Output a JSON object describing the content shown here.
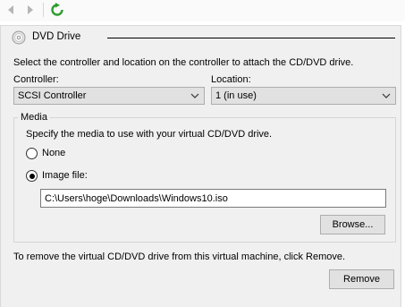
{
  "toolbar": {
    "back_icon": "arrow-left-icon",
    "forward_icon": "arrow-right-icon",
    "refresh_icon": "refresh-icon",
    "refresh_color": "#2e9c2e"
  },
  "section": {
    "title": "DVD Drive",
    "icon": "dvd-disc-icon"
  },
  "instructions": "Select the controller and location on the controller to attach the CD/DVD drive.",
  "controller": {
    "label": "Controller:",
    "value": "SCSI Controller"
  },
  "location": {
    "label": "Location:",
    "value": "1 (in use)"
  },
  "media": {
    "group_label": "Media",
    "description": "Specify the media to use with your virtual CD/DVD drive.",
    "none_label": "None",
    "image_file_label": "Image file:",
    "selected": "image_file",
    "image_path": "C:\\Users\\hoge\\Downloads\\Windows10.iso",
    "browse_label": "Browse..."
  },
  "remove": {
    "text": "To remove the virtual CD/DVD drive from this virtual machine, click Remove.",
    "button_label": "Remove"
  }
}
